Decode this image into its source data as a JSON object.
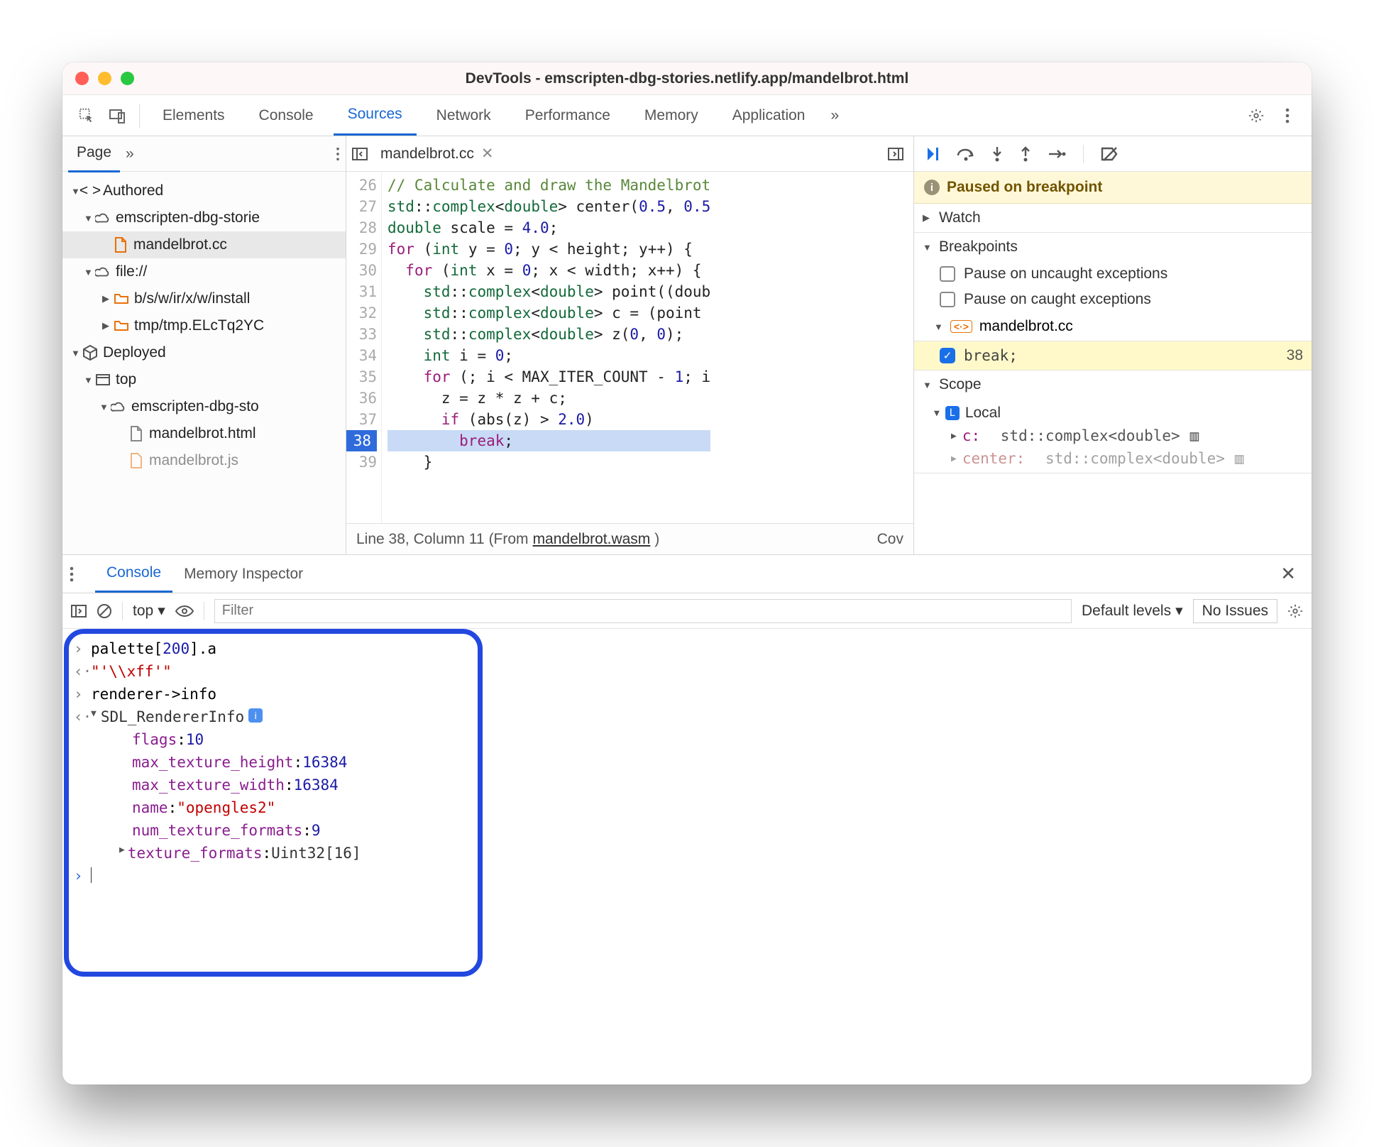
{
  "window_title": "DevTools - emscripten-dbg-stories.netlify.app/mandelbrot.html",
  "tabs": [
    "Elements",
    "Console",
    "Sources",
    "Network",
    "Performance",
    "Memory",
    "Application"
  ],
  "tabs_overflow": "»",
  "active_tab": "Sources",
  "nav": {
    "page_label": "Page",
    "more": "»",
    "tree": {
      "authored": "Authored",
      "host": "emscripten-dbg-storie",
      "file_cc": "mandelbrot.cc",
      "file_scheme": "file://",
      "folder1": "b/s/w/ir/x/w/install",
      "folder2": "tmp/tmp.ELcTq2YC",
      "deployed": "Deployed",
      "top": "top",
      "host2": "emscripten-dbg-sto",
      "file_html": "mandelbrot.html",
      "file_js": "mandelbrot.js"
    }
  },
  "editor": {
    "tabname": "mandelbrot.cc",
    "first_line": 26,
    "lines": [
      "// Calculate and draw the Mandelbrot",
      "std::complex<double> center(0.5, 0.5",
      "double scale = 4.0;",
      "for (int y = 0; y < height; y++) {",
      "  for (int x = 0; x < width; x++) {",
      "    std::complex<double> point((doub",
      "    std::complex<double> c = (point ",
      "    std::complex<double> z(0, 0);",
      "    int i = 0;",
      "    for (; i < MAX_ITER_COUNT - 1; i",
      "      z = z * z + c;",
      "      if (abs(z) > 2.0)",
      "        break;",
      "    }"
    ],
    "highlight_line": 38,
    "status_line": "Line 38, Column 11",
    "status_from": "(From ",
    "status_link": "mandelbrot.wasm",
    "status_tail": ")",
    "status_cov": "Cov"
  },
  "right": {
    "paused": "Paused on breakpoint",
    "watch": "Watch",
    "breakpoints": "Breakpoints",
    "pause_uncaught": "Pause on uncaught exceptions",
    "pause_caught": "Pause on caught exceptions",
    "bp_file": "mandelbrot.cc",
    "bp_text": "break;",
    "bp_line": "38",
    "scope_label": "Scope",
    "local_label": "Local",
    "scope_c_key": "c:",
    "scope_c_val": "std::complex<double>",
    "scope_center_key": "center:",
    "scope_center_val": "std::complex<double>"
  },
  "drawer": {
    "tabs": [
      "Console",
      "Memory Inspector"
    ],
    "active": "Console",
    "context": "top",
    "filter_placeholder": "Filter",
    "levels": "Default levels",
    "issues": "No Issues"
  },
  "console": {
    "entries": [
      {
        "kind": "in",
        "text": "palette[200].a"
      },
      {
        "kind": "out_str",
        "text": "\"'\\\\xff'\""
      },
      {
        "kind": "in",
        "text": "renderer->info"
      },
      {
        "kind": "out_obj",
        "name": "SDL_RendererInfo",
        "props": [
          {
            "k": "flags",
            "v": "10",
            "t": "num"
          },
          {
            "k": "max_texture_height",
            "v": "16384",
            "t": "num"
          },
          {
            "k": "max_texture_width",
            "v": "16384",
            "t": "num"
          },
          {
            "k": "name",
            "v": "\"opengles2\"",
            "t": "str"
          },
          {
            "k": "num_texture_formats",
            "v": "9",
            "t": "num"
          },
          {
            "k": "texture_formats",
            "v": "Uint32[16]",
            "t": "type",
            "expand": true
          }
        ]
      }
    ],
    "index_color_text": "200"
  }
}
